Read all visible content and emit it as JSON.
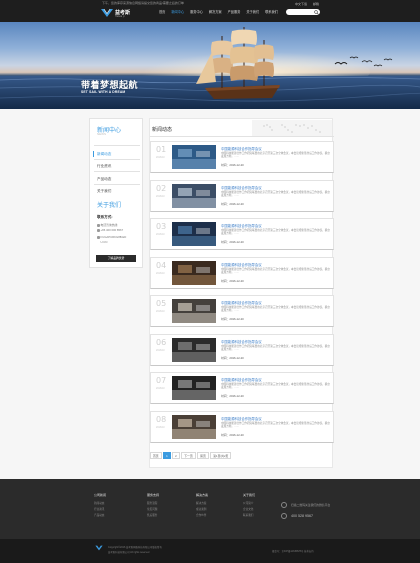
{
  "header": {
    "top_note": "下午，您的库存来源信息网络请提交您的商品/需要之后的订单",
    "logo_name": "益考斯",
    "logo_sub": "Haiwai yi",
    "nav": [
      "首页",
      "新闻中心",
      "服务中心",
      "解决方案",
      "产品服务",
      "关于我们",
      "联系我们"
    ],
    "nav_active_index": 1,
    "top_links": [
      "中文下载",
      "邮箱"
    ],
    "search_placeholder": ""
  },
  "banner": {
    "title": "带着梦想起航",
    "subtitle": "SET SAIL WITH A DREAM"
  },
  "sidebar": {
    "title": "新闻中心",
    "title_sub": "NEWS",
    "items": [
      "新闻动态",
      "行业资讯",
      "产品动态",
      "关于我们"
    ],
    "active_index": 0,
    "about_title": "关于我们",
    "contact_heading": "联系方式:",
    "contact_lines": [
      "电话咨询热线:",
      "+86 400 000 8567",
      "FUGAPURKG8B.ED",
      "U.CN"
    ],
    "button_label": "了解品牌优势"
  },
  "content": {
    "title": "新闻动态",
    "news": [
      {
        "num": "01",
        "tag": "2016/10",
        "title": "中国能源科技合作指导会议",
        "desc": "中国科技能源合作工作研究联盟在北京召开第三次全体会议，本会议增新签约后工作协议，确立发展方向，……",
        "time": "时间：2016-12-20"
      },
      {
        "num": "02",
        "tag": "2016/10",
        "title": "中国能源科技合作指导会议",
        "desc": "中国科技能源合作工作研究联盟在北京召开第三次全体会议，本会议增新签约后工作协议，确立发展方向，……",
        "time": "时间：2016-12-20"
      },
      {
        "num": "03",
        "tag": "2016/10",
        "title": "中国能源科技合作指导会议",
        "desc": "中国科技能源合作工作研究联盟在北京召开第三次全体会议，本会议增新签约后工作协议，确立发展方向，……",
        "time": "时间：2016-12-20"
      },
      {
        "num": "04",
        "tag": "2016/10",
        "title": "中国能源科技合作指导会议",
        "desc": "中国科技能源合作工作研究联盟在北京召开第三次全体会议，本会议增新签约后工作协议，确立发展方向，……",
        "time": "时间：2016-12-20"
      },
      {
        "num": "05",
        "tag": "2016/10",
        "title": "中国能源科技合作指导会议",
        "desc": "中国科技能源合作工作研究联盟在北京召开第三次全体会议，本会议增新签约后工作协议，确立发展方向，……",
        "time": "时间：2016-12-20"
      },
      {
        "num": "06",
        "tag": "2016/10",
        "title": "中国能源科技合作指导会议",
        "desc": "中国科技能源合作工作研究联盟在北京召开第三次全体会议，本会议增新签约后工作协议，确立发展方向，……",
        "time": "时间：2016-12-20"
      },
      {
        "num": "07",
        "tag": "2016/10",
        "title": "中国能源科技合作指导会议",
        "desc": "中国科技能源合作工作研究联盟在北京召开第三次全体会议，本会议增新签约后工作协议，确立发展方向，……",
        "time": "时间：2016-12-20"
      },
      {
        "num": "08",
        "tag": "2016/10",
        "title": "中国能源科技合作指导会议",
        "desc": "中国科技能源合作工作研究联盟在北京召开第三次全体会议，本会议增新签约后工作协议，确立发展方向，……",
        "time": "时间：2016-12-20"
      }
    ],
    "pager": [
      "首页",
      "1",
      "2",
      "下一页",
      "尾页",
      "第1页/共2页"
    ],
    "pager_active_index": 1
  },
  "footer": {
    "columns": [
      {
        "heading": "公司新闻",
        "links": [
          "新闻动态",
          "行业资讯",
          "产品动态"
        ]
      },
      {
        "heading": "服务支持",
        "links": [
          "服务流程",
          "常见问题",
          "售后服务"
        ]
      },
      {
        "heading": "解决方案",
        "links": [
          "解决方案",
          "成功案例",
          "合作伙伴"
        ]
      },
      {
        "heading": "关于我们",
        "links": [
          "公司简介",
          "企业文化",
          "联系我们"
        ]
      }
    ],
    "qr_text": "扫描二维码关注我们的微信平台",
    "phone": "400 528 9567",
    "copyright_lines": [
      "Copyright©2016 益考斯网络科技有限公司版权所有",
      "益考斯科技有限公司 All rights reserved"
    ],
    "right_text": "备案号：京ICP备12345678号 技术支持"
  },
  "colors": {
    "accent": "#3b9be0",
    "header_bg": "#1e1e1e",
    "footer_bg": "#2b2b2b",
    "bottom_bg": "#1a1a1a",
    "news_title": "#3b7dc7"
  }
}
